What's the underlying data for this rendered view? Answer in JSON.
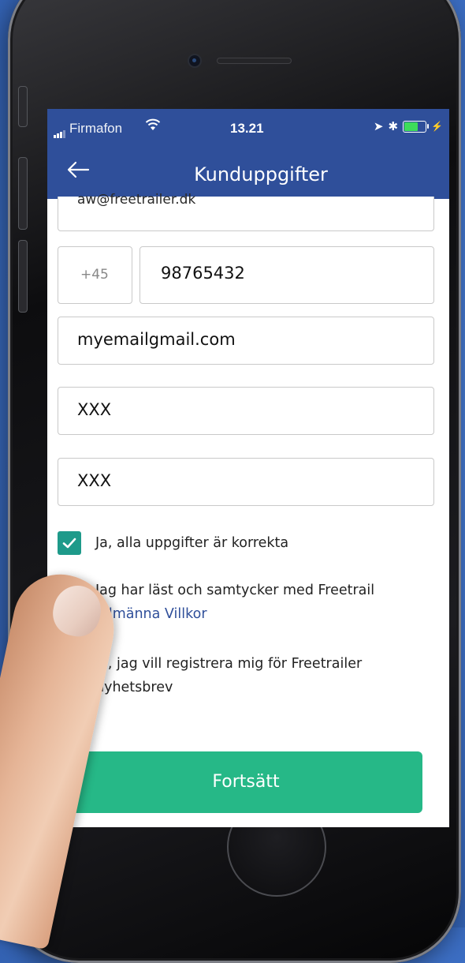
{
  "status_bar": {
    "carrier": "Firmafon",
    "time": "13.21"
  },
  "nav": {
    "title": "Kunduppgifter"
  },
  "form": {
    "previous_field_value": "aw@freetrailer.dk",
    "country_code": "+45",
    "phone": "98765432",
    "email": "myemailgmail.com",
    "field_4": "XXX",
    "field_5": "XXX"
  },
  "checkboxes": [
    {
      "label": "Ja, alla uppgifter är korrekta",
      "checked": true
    },
    {
      "label": "Jag har läst och samtycker med Freetrail",
      "link": "Allmänna Villkor",
      "checked": true
    },
    {
      "label": "Ja, jag vill registrera mig för Freetrailer",
      "label_line2": "nyhetsbrev",
      "checked": true
    }
  ],
  "cta": {
    "label": "Fortsätt"
  },
  "colors": {
    "nav_bg": "#2f4f9a",
    "checkbox": "#1e9a8a",
    "cta": "#26b887",
    "link": "#2f4f9a"
  },
  "icons": [
    "signal-bars-icon",
    "wifi-icon",
    "location-arrow-icon",
    "bluetooth-icon",
    "battery-icon",
    "back-arrow-icon",
    "checkmark-icon"
  ]
}
